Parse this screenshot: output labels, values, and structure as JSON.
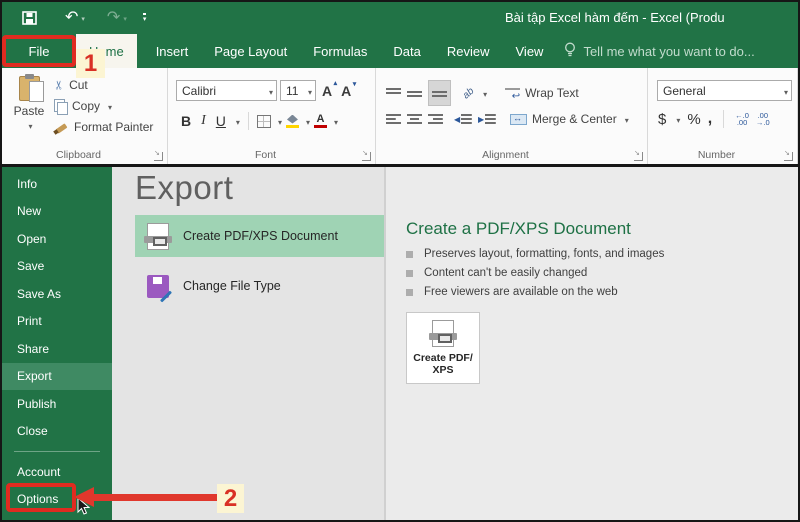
{
  "colors": {
    "excel_green": "#217346",
    "export_highlight": "#3f8a63",
    "selection_mint": "#9fd3b4",
    "heading_green": "#1e7145",
    "annotation_red": "#e02b20",
    "badge_bg": "#fcf5d3"
  },
  "titlebar": {
    "title": "Bài tập Excel hàm đếm - Excel (Produ"
  },
  "tabs": {
    "file": "File",
    "items": [
      "Home",
      "Insert",
      "Page Layout",
      "Formulas",
      "Data",
      "Review",
      "View"
    ],
    "active": "Home",
    "tellme": "Tell me what you want to do..."
  },
  "ribbon": {
    "clipboard": {
      "label": "Clipboard",
      "paste": "Paste",
      "cut": "Cut",
      "copy": "Copy",
      "format_painter": "Format Painter"
    },
    "font": {
      "label": "Font",
      "family": "Calibri",
      "size": "11",
      "bold": "B",
      "italic": "I",
      "underline": "U"
    },
    "alignment": {
      "label": "Alignment",
      "wrap_text": "Wrap Text",
      "merge_center": "Merge & Center"
    },
    "number": {
      "label": "Number",
      "format": "General",
      "currency": "$",
      "percent": "%",
      "comma": ",",
      "increase_decimal": "←.0\n.00",
      "decrease_decimal": ".00\n→.0"
    }
  },
  "backstage": {
    "nav": [
      "Info",
      "New",
      "Open",
      "Save",
      "Save As",
      "Print",
      "Share",
      "Export",
      "Publish",
      "Close",
      "Account",
      "Options"
    ],
    "active_item": "Export",
    "title": "Export",
    "list": [
      {
        "label": "Create PDF/XPS Document",
        "selected": true
      },
      {
        "label": "Change File Type",
        "selected": false
      }
    ],
    "detail": {
      "heading": "Create a PDF/XPS Document",
      "bullets": [
        "Preserves layout, formatting, fonts, and images",
        "Content can't be easily changed",
        "Free viewers are available on the web"
      ],
      "button_label": "Create PDF/\nXPS"
    }
  },
  "annotations": {
    "step1": "1",
    "step2": "2"
  }
}
